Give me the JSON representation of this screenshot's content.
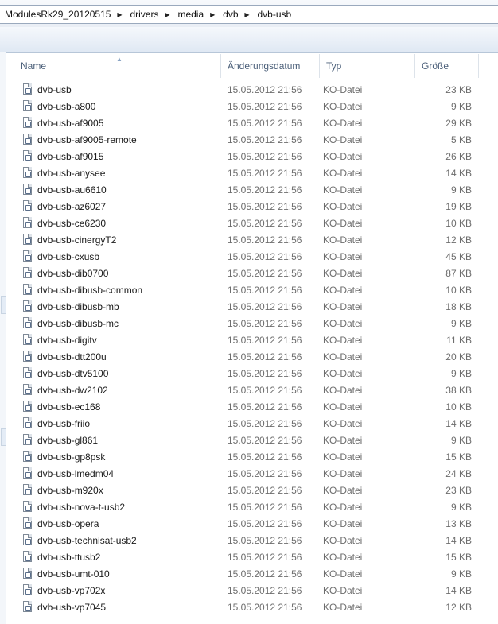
{
  "breadcrumb": [
    "ModulesRk29_20120515",
    "drivers",
    "media",
    "dvb",
    "dvb-usb"
  ],
  "columns": {
    "name": "Name",
    "date": "Änderungsdatum",
    "type": "Typ",
    "size": "Größe"
  },
  "files": [
    {
      "name": "dvb-usb",
      "date": "15.05.2012 21:56",
      "type": "KO-Datei",
      "size": "23 KB"
    },
    {
      "name": "dvb-usb-a800",
      "date": "15.05.2012 21:56",
      "type": "KO-Datei",
      "size": "9 KB"
    },
    {
      "name": "dvb-usb-af9005",
      "date": "15.05.2012 21:56",
      "type": "KO-Datei",
      "size": "29 KB"
    },
    {
      "name": "dvb-usb-af9005-remote",
      "date": "15.05.2012 21:56",
      "type": "KO-Datei",
      "size": "5 KB"
    },
    {
      "name": "dvb-usb-af9015",
      "date": "15.05.2012 21:56",
      "type": "KO-Datei",
      "size": "26 KB"
    },
    {
      "name": "dvb-usb-anysee",
      "date": "15.05.2012 21:56",
      "type": "KO-Datei",
      "size": "14 KB"
    },
    {
      "name": "dvb-usb-au6610",
      "date": "15.05.2012 21:56",
      "type": "KO-Datei",
      "size": "9 KB"
    },
    {
      "name": "dvb-usb-az6027",
      "date": "15.05.2012 21:56",
      "type": "KO-Datei",
      "size": "19 KB"
    },
    {
      "name": "dvb-usb-ce6230",
      "date": "15.05.2012 21:56",
      "type": "KO-Datei",
      "size": "10 KB"
    },
    {
      "name": "dvb-usb-cinergyT2",
      "date": "15.05.2012 21:56",
      "type": "KO-Datei",
      "size": "12 KB"
    },
    {
      "name": "dvb-usb-cxusb",
      "date": "15.05.2012 21:56",
      "type": "KO-Datei",
      "size": "45 KB"
    },
    {
      "name": "dvb-usb-dib0700",
      "date": "15.05.2012 21:56",
      "type": "KO-Datei",
      "size": "87 KB"
    },
    {
      "name": "dvb-usb-dibusb-common",
      "date": "15.05.2012 21:56",
      "type": "KO-Datei",
      "size": "10 KB"
    },
    {
      "name": "dvb-usb-dibusb-mb",
      "date": "15.05.2012 21:56",
      "type": "KO-Datei",
      "size": "18 KB"
    },
    {
      "name": "dvb-usb-dibusb-mc",
      "date": "15.05.2012 21:56",
      "type": "KO-Datei",
      "size": "9 KB"
    },
    {
      "name": "dvb-usb-digitv",
      "date": "15.05.2012 21:56",
      "type": "KO-Datei",
      "size": "11 KB"
    },
    {
      "name": "dvb-usb-dtt200u",
      "date": "15.05.2012 21:56",
      "type": "KO-Datei",
      "size": "20 KB"
    },
    {
      "name": "dvb-usb-dtv5100",
      "date": "15.05.2012 21:56",
      "type": "KO-Datei",
      "size": "9 KB"
    },
    {
      "name": "dvb-usb-dw2102",
      "date": "15.05.2012 21:56",
      "type": "KO-Datei",
      "size": "38 KB"
    },
    {
      "name": "dvb-usb-ec168",
      "date": "15.05.2012 21:56",
      "type": "KO-Datei",
      "size": "10 KB"
    },
    {
      "name": "dvb-usb-friio",
      "date": "15.05.2012 21:56",
      "type": "KO-Datei",
      "size": "14 KB"
    },
    {
      "name": "dvb-usb-gl861",
      "date": "15.05.2012 21:56",
      "type": "KO-Datei",
      "size": "9 KB"
    },
    {
      "name": "dvb-usb-gp8psk",
      "date": "15.05.2012 21:56",
      "type": "KO-Datei",
      "size": "15 KB"
    },
    {
      "name": "dvb-usb-lmedm04",
      "date": "15.05.2012 21:56",
      "type": "KO-Datei",
      "size": "24 KB"
    },
    {
      "name": "dvb-usb-m920x",
      "date": "15.05.2012 21:56",
      "type": "KO-Datei",
      "size": "23 KB"
    },
    {
      "name": "dvb-usb-nova-t-usb2",
      "date": "15.05.2012 21:56",
      "type": "KO-Datei",
      "size": "9 KB"
    },
    {
      "name": "dvb-usb-opera",
      "date": "15.05.2012 21:56",
      "type": "KO-Datei",
      "size": "13 KB"
    },
    {
      "name": "dvb-usb-technisat-usb2",
      "date": "15.05.2012 21:56",
      "type": "KO-Datei",
      "size": "14 KB"
    },
    {
      "name": "dvb-usb-ttusb2",
      "date": "15.05.2012 21:56",
      "type": "KO-Datei",
      "size": "15 KB"
    },
    {
      "name": "dvb-usb-umt-010",
      "date": "15.05.2012 21:56",
      "type": "KO-Datei",
      "size": "9 KB"
    },
    {
      "name": "dvb-usb-vp702x",
      "date": "15.05.2012 21:56",
      "type": "KO-Datei",
      "size": "14 KB"
    },
    {
      "name": "dvb-usb-vp7045",
      "date": "15.05.2012 21:56",
      "type": "KO-Datei",
      "size": "12 KB"
    }
  ]
}
